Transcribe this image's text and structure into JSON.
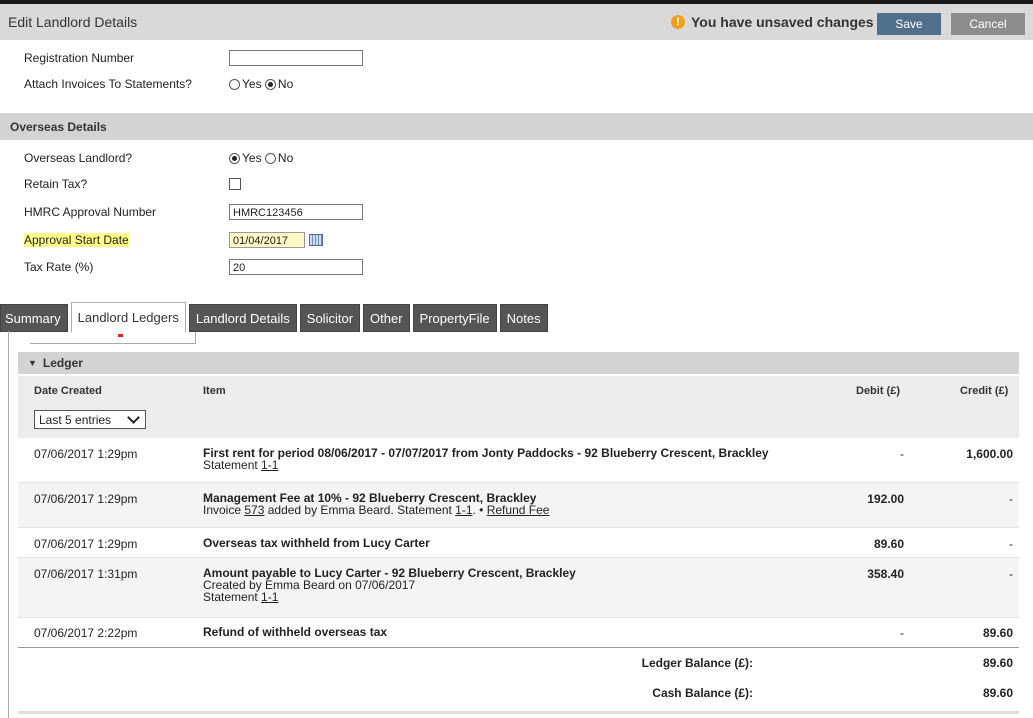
{
  "header": {
    "title": "Edit Landlord Details",
    "unsaved_text": "You have unsaved changes",
    "save_label": "Save",
    "cancel_label": "Cancel"
  },
  "form": {
    "registration_number": {
      "label": "Registration Number",
      "value": ""
    },
    "attach_invoices": {
      "label": "Attach Invoices To Statements?",
      "yes": "Yes",
      "no": "No",
      "selected": "No"
    }
  },
  "overseas": {
    "section_title": "Overseas Details",
    "overseas_landlord": {
      "label": "Overseas Landlord?",
      "yes": "Yes",
      "no": "No",
      "selected": "Yes"
    },
    "retain_tax": {
      "label": "Retain Tax?",
      "checked": false
    },
    "hmrc_number": {
      "label": "HMRC Approval Number",
      "value": "HMRC123456"
    },
    "approval_start": {
      "label": "Approval Start Date",
      "value": "01/04/2017"
    },
    "tax_rate": {
      "label": "Tax Rate (%)",
      "value": "20"
    }
  },
  "tabs": [
    "Summary",
    "Landlord Ledgers",
    "Landlord Details",
    "Solicitor",
    "Other",
    "PropertyFile",
    "Notes"
  ],
  "active_tab": "Landlord Ledgers",
  "ledger": {
    "title": "Ledger",
    "columns": {
      "date": "Date Created",
      "item": "Item",
      "debit": "Debit (£)",
      "credit": "Credit (£)"
    },
    "filter": "Last 5 entries",
    "rows": [
      {
        "date": "07/06/2017 1:29pm",
        "item": "First rent for period 08/06/2017 - 07/07/2017 from Jonty Paddocks - 92 Blueberry Crescent, Brackley",
        "sub_prefix": "Statement ",
        "sub_link": "1-1",
        "debit": "-",
        "credit": "1,600.00"
      },
      {
        "date": "07/06/2017 1:29pm",
        "item": "Management Fee at 10% - 92 Blueberry Crescent, Brackley",
        "sub_a": "Invoice ",
        "sub_link1": "573",
        "sub_b": " added by Emma Beard. Statement ",
        "sub_link2": "1-1",
        "sub_c": ".  • ",
        "sub_link3": "Refund Fee",
        "debit": "192.00",
        "credit": "-"
      },
      {
        "date": "07/06/2017 1:29pm",
        "item": "Overseas tax withheld from Lucy Carter",
        "debit": "89.60",
        "credit": "-"
      },
      {
        "date": "07/06/2017 1:31pm",
        "item": "Amount payable to Lucy Carter - 92 Blueberry Crescent, Brackley",
        "sub_line1": "Created by Emma Beard on 07/06/2017",
        "sub_prefix": "Statement ",
        "sub_link": "1-1",
        "debit": "358.40",
        "credit": "-"
      },
      {
        "date": "07/06/2017 2:22pm",
        "item": "Refund of withheld overseas tax",
        "debit": "-",
        "credit": "89.60"
      }
    ],
    "ledger_balance_label": "Ledger Balance (£):",
    "ledger_balance": "89.60",
    "cash_balance_label": "Cash Balance (£):",
    "cash_balance": "89.60"
  }
}
